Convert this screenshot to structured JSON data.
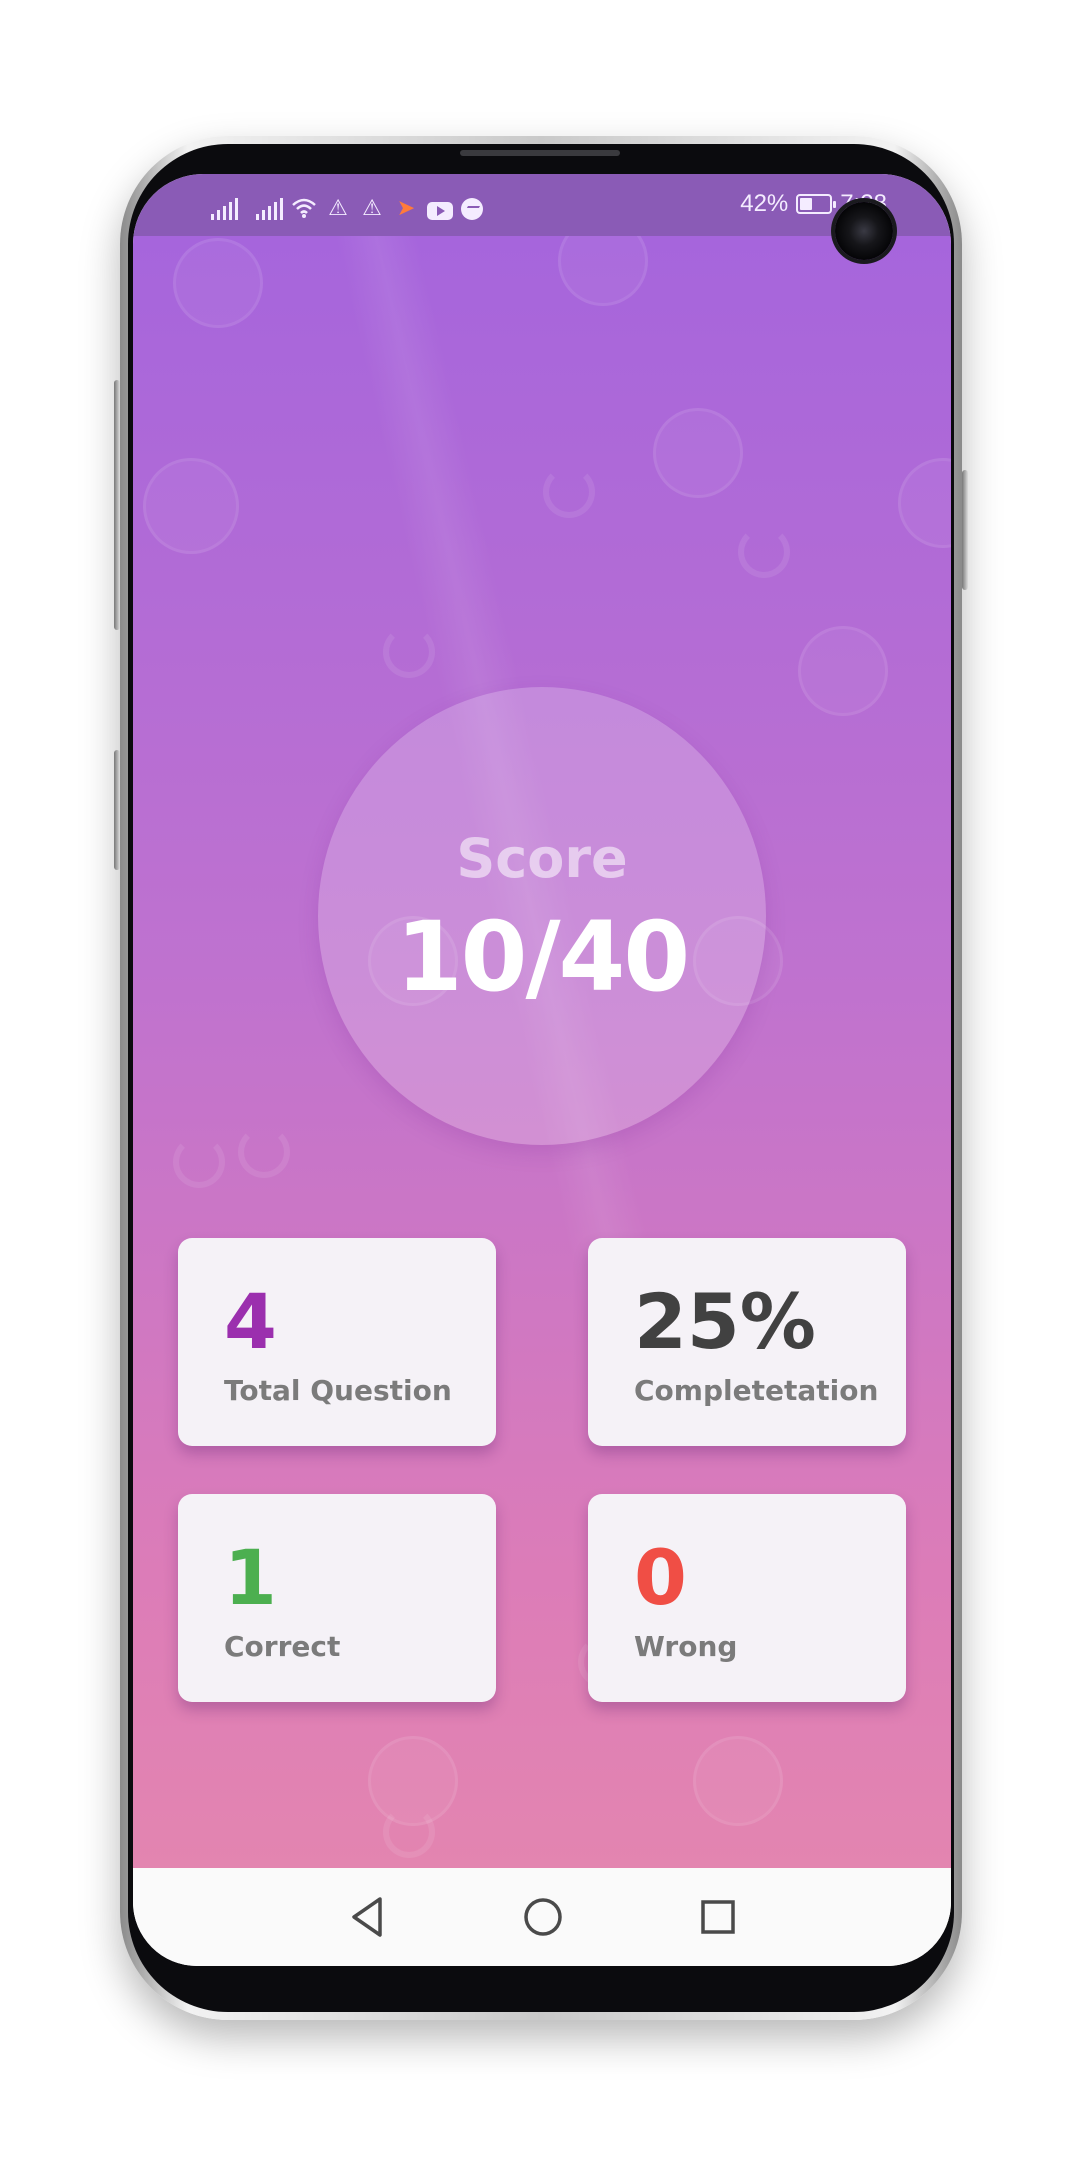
{
  "status_bar": {
    "battery_text": "42%",
    "battery_level": 0.42,
    "time": "7:28",
    "icons": [
      "signal-icon",
      "signal-icon",
      "wifi-icon",
      "warning-icon",
      "warning-icon",
      "app-notification-icon",
      "youtube-icon",
      "messenger-icon"
    ]
  },
  "score": {
    "label": "Score",
    "value": "10/40"
  },
  "stats": [
    {
      "value": "4",
      "label": "Total Question",
      "color": "#9b2fae"
    },
    {
      "value": "25%",
      "label": "Completetation",
      "color": "#414141"
    },
    {
      "value": "1",
      "label": "Correct",
      "color": "#4caf50"
    },
    {
      "value": "0",
      "label": "Wrong",
      "color": "#f04e45"
    }
  ],
  "nav": {
    "icons": [
      "back-icon",
      "home-icon",
      "recents-icon"
    ]
  },
  "colors": {
    "gradient_top": "#a665dc",
    "gradient_bottom": "#e385b0",
    "card_background": "#f5f2f7"
  }
}
